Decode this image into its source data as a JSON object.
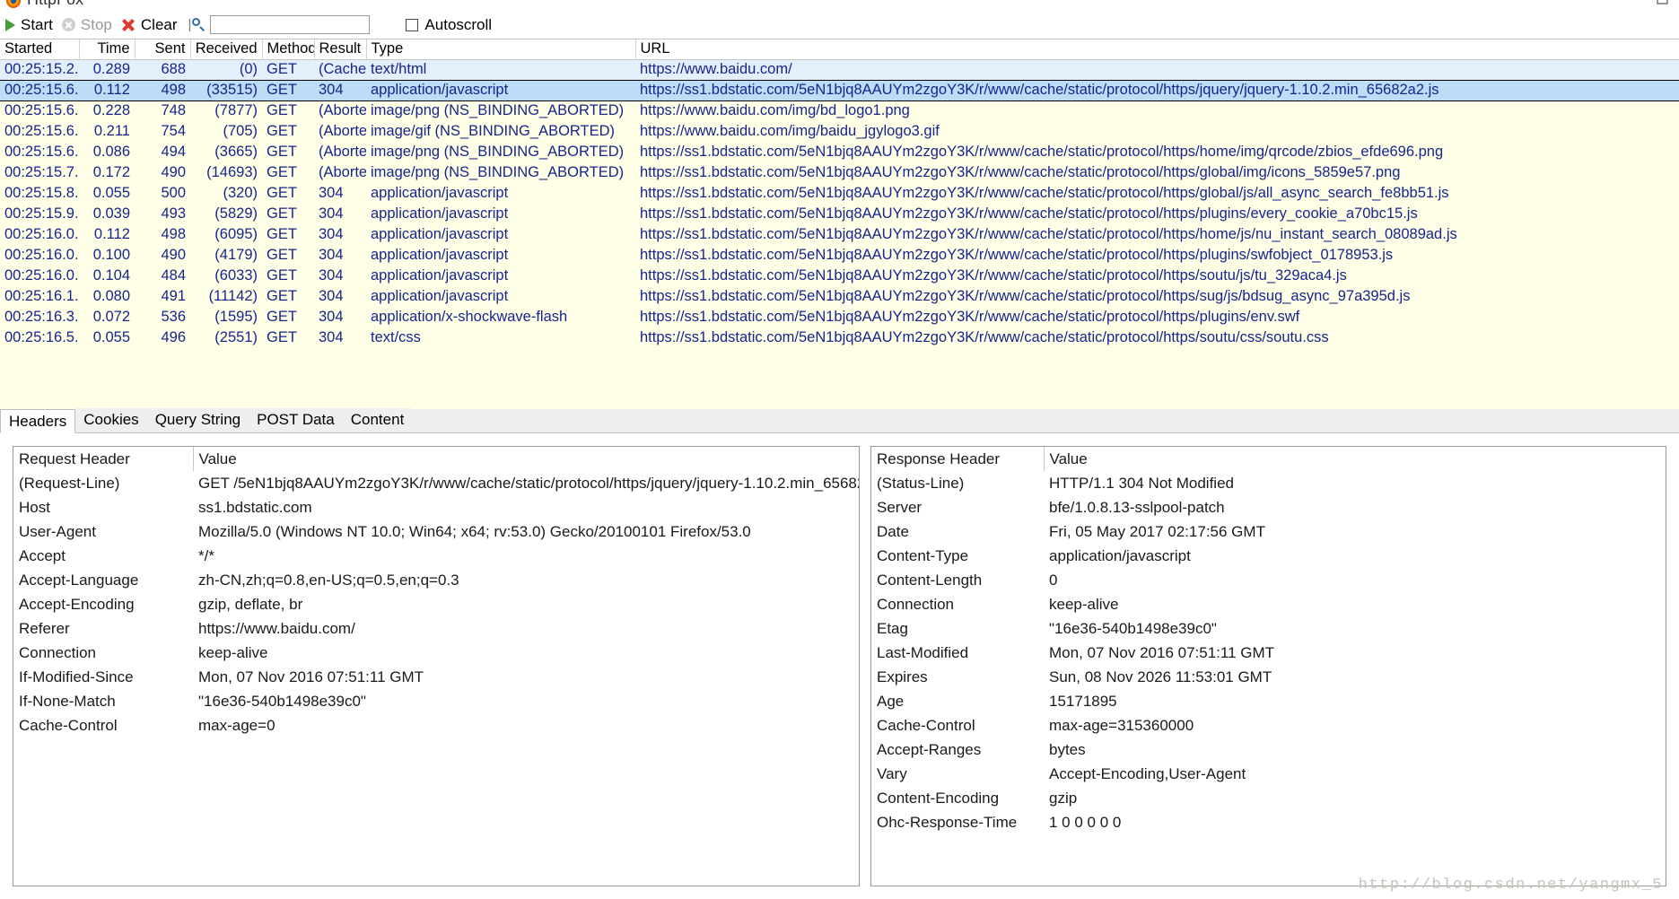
{
  "window": {
    "title": "HttpFox",
    "app_icon": "firefox-icon",
    "maximize_icon": "maximize-icon"
  },
  "toolbar": {
    "start_label": "Start",
    "start_icon": "play-icon",
    "stop_label": "Stop",
    "stop_icon": "stop-icon",
    "clear_label": "Clear",
    "clear_icon": "close-x-icon",
    "separator": "|",
    "search_icon": "search-icon",
    "filter_value": "",
    "filter_placeholder": "",
    "autoscroll_label": "Autoscroll",
    "autoscroll_checked": false
  },
  "grid": {
    "columns": [
      {
        "key": "started",
        "label": "Started",
        "align": "left"
      },
      {
        "key": "time",
        "label": "Time",
        "align": "right"
      },
      {
        "key": "sent",
        "label": "Sent",
        "align": "right"
      },
      {
        "key": "received",
        "label": "Received",
        "align": "right"
      },
      {
        "key": "method",
        "label": "Method",
        "align": "left"
      },
      {
        "key": "result",
        "label": "Result",
        "align": "left"
      },
      {
        "key": "type",
        "label": "Type",
        "align": "left"
      },
      {
        "key": "url",
        "label": "URL",
        "align": "left"
      }
    ],
    "rows": [
      {
        "state": "cache",
        "started": "00:25:15.2...",
        "time": "0.289",
        "sent": "688",
        "received": "(0)",
        "method": "GET",
        "result": "(Cache)",
        "type": "text/html",
        "url": "https://www.baidu.com/"
      },
      {
        "state": "selected",
        "started": "00:25:15.6...",
        "time": "0.112",
        "sent": "498",
        "received": "(33515)",
        "method": "GET",
        "result": "304",
        "type": "application/javascript",
        "url": "https://ss1.bdstatic.com/5eN1bjq8AAUYm2zgoY3K/r/www/cache/static/protocol/https/jquery/jquery-1.10.2.min_65682a2.js"
      },
      {
        "state": "plain",
        "started": "00:25:15.6...",
        "time": "0.228",
        "sent": "748",
        "received": "(7877)",
        "method": "GET",
        "result": "(Aborted)",
        "type": "image/png (NS_BINDING_ABORTED)",
        "url": "https://www.baidu.com/img/bd_logo1.png"
      },
      {
        "state": "plain",
        "started": "00:25:15.6...",
        "time": "0.211",
        "sent": "754",
        "received": "(705)",
        "method": "GET",
        "result": "(Aborted)",
        "type": "image/gif (NS_BINDING_ABORTED)",
        "url": "https://www.baidu.com/img/baidu_jgylogo3.gif"
      },
      {
        "state": "plain",
        "started": "00:25:15.6...",
        "time": "0.086",
        "sent": "494",
        "received": "(3665)",
        "method": "GET",
        "result": "(Aborted)",
        "type": "image/png (NS_BINDING_ABORTED)",
        "url": "https://ss1.bdstatic.com/5eN1bjq8AAUYm2zgoY3K/r/www/cache/static/protocol/https/home/img/qrcode/zbios_efde696.png"
      },
      {
        "state": "plain",
        "started": "00:25:15.7...",
        "time": "0.172",
        "sent": "490",
        "received": "(14693)",
        "method": "GET",
        "result": "(Aborted)",
        "type": "image/png (NS_BINDING_ABORTED)",
        "url": "https://ss1.bdstatic.com/5eN1bjq8AAUYm2zgoY3K/r/www/cache/static/protocol/https/global/img/icons_5859e57.png"
      },
      {
        "state": "plain",
        "started": "00:25:15.8...",
        "time": "0.055",
        "sent": "500",
        "received": "(320)",
        "method": "GET",
        "result": "304",
        "type": "application/javascript",
        "url": "https://ss1.bdstatic.com/5eN1bjq8AAUYm2zgoY3K/r/www/cache/static/protocol/https/global/js/all_async_search_fe8bb51.js"
      },
      {
        "state": "plain",
        "started": "00:25:15.9...",
        "time": "0.039",
        "sent": "493",
        "received": "(5829)",
        "method": "GET",
        "result": "304",
        "type": "application/javascript",
        "url": "https://ss1.bdstatic.com/5eN1bjq8AAUYm2zgoY3K/r/www/cache/static/protocol/https/plugins/every_cookie_a70bc15.js"
      },
      {
        "state": "plain",
        "started": "00:25:16.0...",
        "time": "0.112",
        "sent": "498",
        "received": "(6095)",
        "method": "GET",
        "result": "304",
        "type": "application/javascript",
        "url": "https://ss1.bdstatic.com/5eN1bjq8AAUYm2zgoY3K/r/www/cache/static/protocol/https/home/js/nu_instant_search_08089ad.js"
      },
      {
        "state": "plain",
        "started": "00:25:16.0...",
        "time": "0.100",
        "sent": "490",
        "received": "(4179)",
        "method": "GET",
        "result": "304",
        "type": "application/javascript",
        "url": "https://ss1.bdstatic.com/5eN1bjq8AAUYm2zgoY3K/r/www/cache/static/protocol/https/plugins/swfobject_0178953.js"
      },
      {
        "state": "plain",
        "started": "00:25:16.0...",
        "time": "0.104",
        "sent": "484",
        "received": "(6033)",
        "method": "GET",
        "result": "304",
        "type": "application/javascript",
        "url": "https://ss1.bdstatic.com/5eN1bjq8AAUYm2zgoY3K/r/www/cache/static/protocol/https/soutu/js/tu_329aca4.js"
      },
      {
        "state": "plain",
        "started": "00:25:16.1...",
        "time": "0.080",
        "sent": "491",
        "received": "(11142)",
        "method": "GET",
        "result": "304",
        "type": "application/javascript",
        "url": "https://ss1.bdstatic.com/5eN1bjq8AAUYm2zgoY3K/r/www/cache/static/protocol/https/sug/js/bdsug_async_97a395d.js"
      },
      {
        "state": "plain",
        "started": "00:25:16.3...",
        "time": "0.072",
        "sent": "536",
        "received": "(1595)",
        "method": "GET",
        "result": "304",
        "type": "application/x-shockwave-flash",
        "url": "https://ss1.bdstatic.com/5eN1bjq8AAUYm2zgoY3K/r/www/cache/static/protocol/https/plugins/env.swf"
      },
      {
        "state": "plain",
        "started": "00:25:16.5...",
        "time": "0.055",
        "sent": "496",
        "received": "(2551)",
        "method": "GET",
        "result": "304",
        "type": "text/css",
        "url": "https://ss1.bdstatic.com/5eN1bjq8AAUYm2zgoY3K/r/www/cache/static/protocol/https/soutu/css/soutu.css"
      }
    ]
  },
  "tabs": [
    {
      "label": "Headers",
      "active": true
    },
    {
      "label": "Cookies",
      "active": false
    },
    {
      "label": "Query String",
      "active": false
    },
    {
      "label": "POST Data",
      "active": false
    },
    {
      "label": "Content",
      "active": false
    }
  ],
  "request_pane": {
    "header_col": "Request Header",
    "value_col": "Value",
    "rows": [
      {
        "name": "(Request-Line)",
        "value": "GET /5eN1bjq8AAUYm2zgoY3K/r/www/cache/static/protocol/https/jquery/jquery-1.10.2.min_65682..."
      },
      {
        "name": "Host",
        "value": "ss1.bdstatic.com"
      },
      {
        "name": "User-Agent",
        "value": "Mozilla/5.0 (Windows NT 10.0; Win64; x64; rv:53.0) Gecko/20100101 Firefox/53.0"
      },
      {
        "name": "Accept",
        "value": "*/*"
      },
      {
        "name": "Accept-Language",
        "value": "zh-CN,zh;q=0.8,en-US;q=0.5,en;q=0.3"
      },
      {
        "name": "Accept-Encoding",
        "value": "gzip, deflate, br"
      },
      {
        "name": "Referer",
        "value": "https://www.baidu.com/"
      },
      {
        "name": "Connection",
        "value": "keep-alive"
      },
      {
        "name": "If-Modified-Since",
        "value": "Mon, 07 Nov 2016 07:51:11 GMT"
      },
      {
        "name": "If-None-Match",
        "value": "\"16e36-540b1498e39c0\""
      },
      {
        "name": "Cache-Control",
        "value": "max-age=0"
      }
    ]
  },
  "response_pane": {
    "header_col": "Response Header",
    "value_col": "Value",
    "rows": [
      {
        "name": "(Status-Line)",
        "value": "HTTP/1.1 304 Not Modified"
      },
      {
        "name": "Server",
        "value": "bfe/1.0.8.13-sslpool-patch"
      },
      {
        "name": "Date",
        "value": "Fri, 05 May 2017 02:17:56 GMT"
      },
      {
        "name": "Content-Type",
        "value": "application/javascript"
      },
      {
        "name": "Content-Length",
        "value": "0"
      },
      {
        "name": "Connection",
        "value": "keep-alive"
      },
      {
        "name": "Etag",
        "value": "\"16e36-540b1498e39c0\""
      },
      {
        "name": "Last-Modified",
        "value": "Mon, 07 Nov 2016 07:51:11 GMT"
      },
      {
        "name": "Expires",
        "value": "Sun, 08 Nov 2026 11:53:01 GMT"
      },
      {
        "name": "Age",
        "value": "15171895"
      },
      {
        "name": "Cache-Control",
        "value": "max-age=315360000"
      },
      {
        "name": "Accept-Ranges",
        "value": "bytes"
      },
      {
        "name": "Vary",
        "value": "Accept-Encoding,User-Agent"
      },
      {
        "name": "Content-Encoding",
        "value": "gzip"
      },
      {
        "name": "Ohc-Response-Time",
        "value": "1 0 0 0 0 0"
      }
    ]
  },
  "watermark": "http://blog.csdn.net/yangmx_5",
  "colors": {
    "row_link": "#17258c",
    "row_alt": "#ffffe8",
    "row_cache": "#e3f0fb",
    "row_selected": "#bedcf5",
    "accent_start": "#4a9a3d",
    "accent_clear": "#e03b2f"
  }
}
